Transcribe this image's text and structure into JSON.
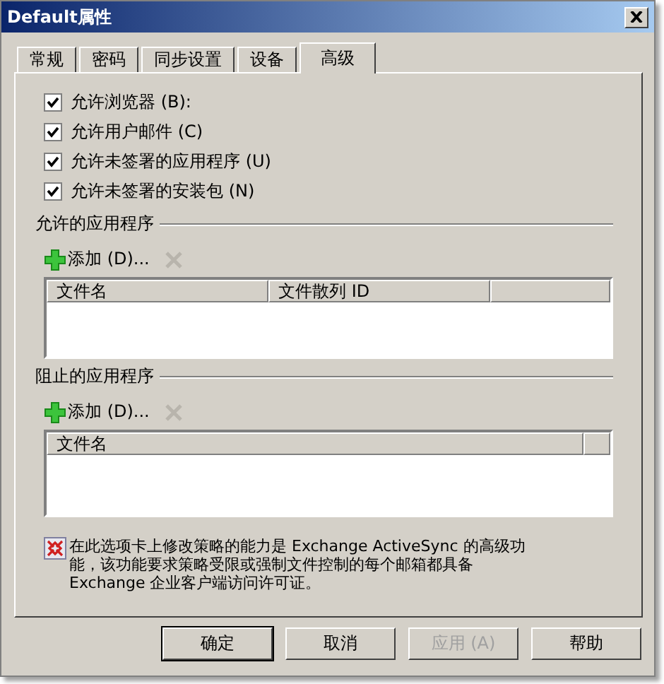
{
  "window": {
    "title": "Default属性"
  },
  "tabs": [
    {
      "label": "常规",
      "selected": false
    },
    {
      "label": "密码",
      "selected": false
    },
    {
      "label": "同步设置",
      "selected": false
    },
    {
      "label": "设备",
      "selected": false
    },
    {
      "label": "高级",
      "selected": true
    }
  ],
  "checkboxes": [
    {
      "label": "允许浏览器 (B):",
      "checked": true
    },
    {
      "label": "允许用户邮件 (C)",
      "checked": true
    },
    {
      "label": "允许未签署的应用程序 (U)",
      "checked": true
    },
    {
      "label": "允许未签署的安装包 (N)",
      "checked": true
    }
  ],
  "sections": [
    {
      "title": "允许的应用程序",
      "add_button": "添加 (D)...",
      "remove_disabled": true,
      "columns": [
        "文件名",
        "文件散列 ID"
      ]
    },
    {
      "title": "阻止的应用程序",
      "add_button": "添加 (D)...",
      "remove_disabled": true,
      "columns": [
        "文件名"
      ]
    }
  ],
  "note": "在此选项卡上修改策略的能力是 Exchange ActiveSync 的高级功能，该功能要求策略受限或强制文件控制的每个邮箱都具备 Exchange 企业客户端访问许可证。",
  "buttons": [
    {
      "label": "确定",
      "default": true,
      "disabled": false
    },
    {
      "label": "取消",
      "default": false,
      "disabled": false
    },
    {
      "label": "应用 (A)",
      "default": false,
      "disabled": true
    },
    {
      "label": "帮助",
      "default": false,
      "disabled": false
    }
  ]
}
